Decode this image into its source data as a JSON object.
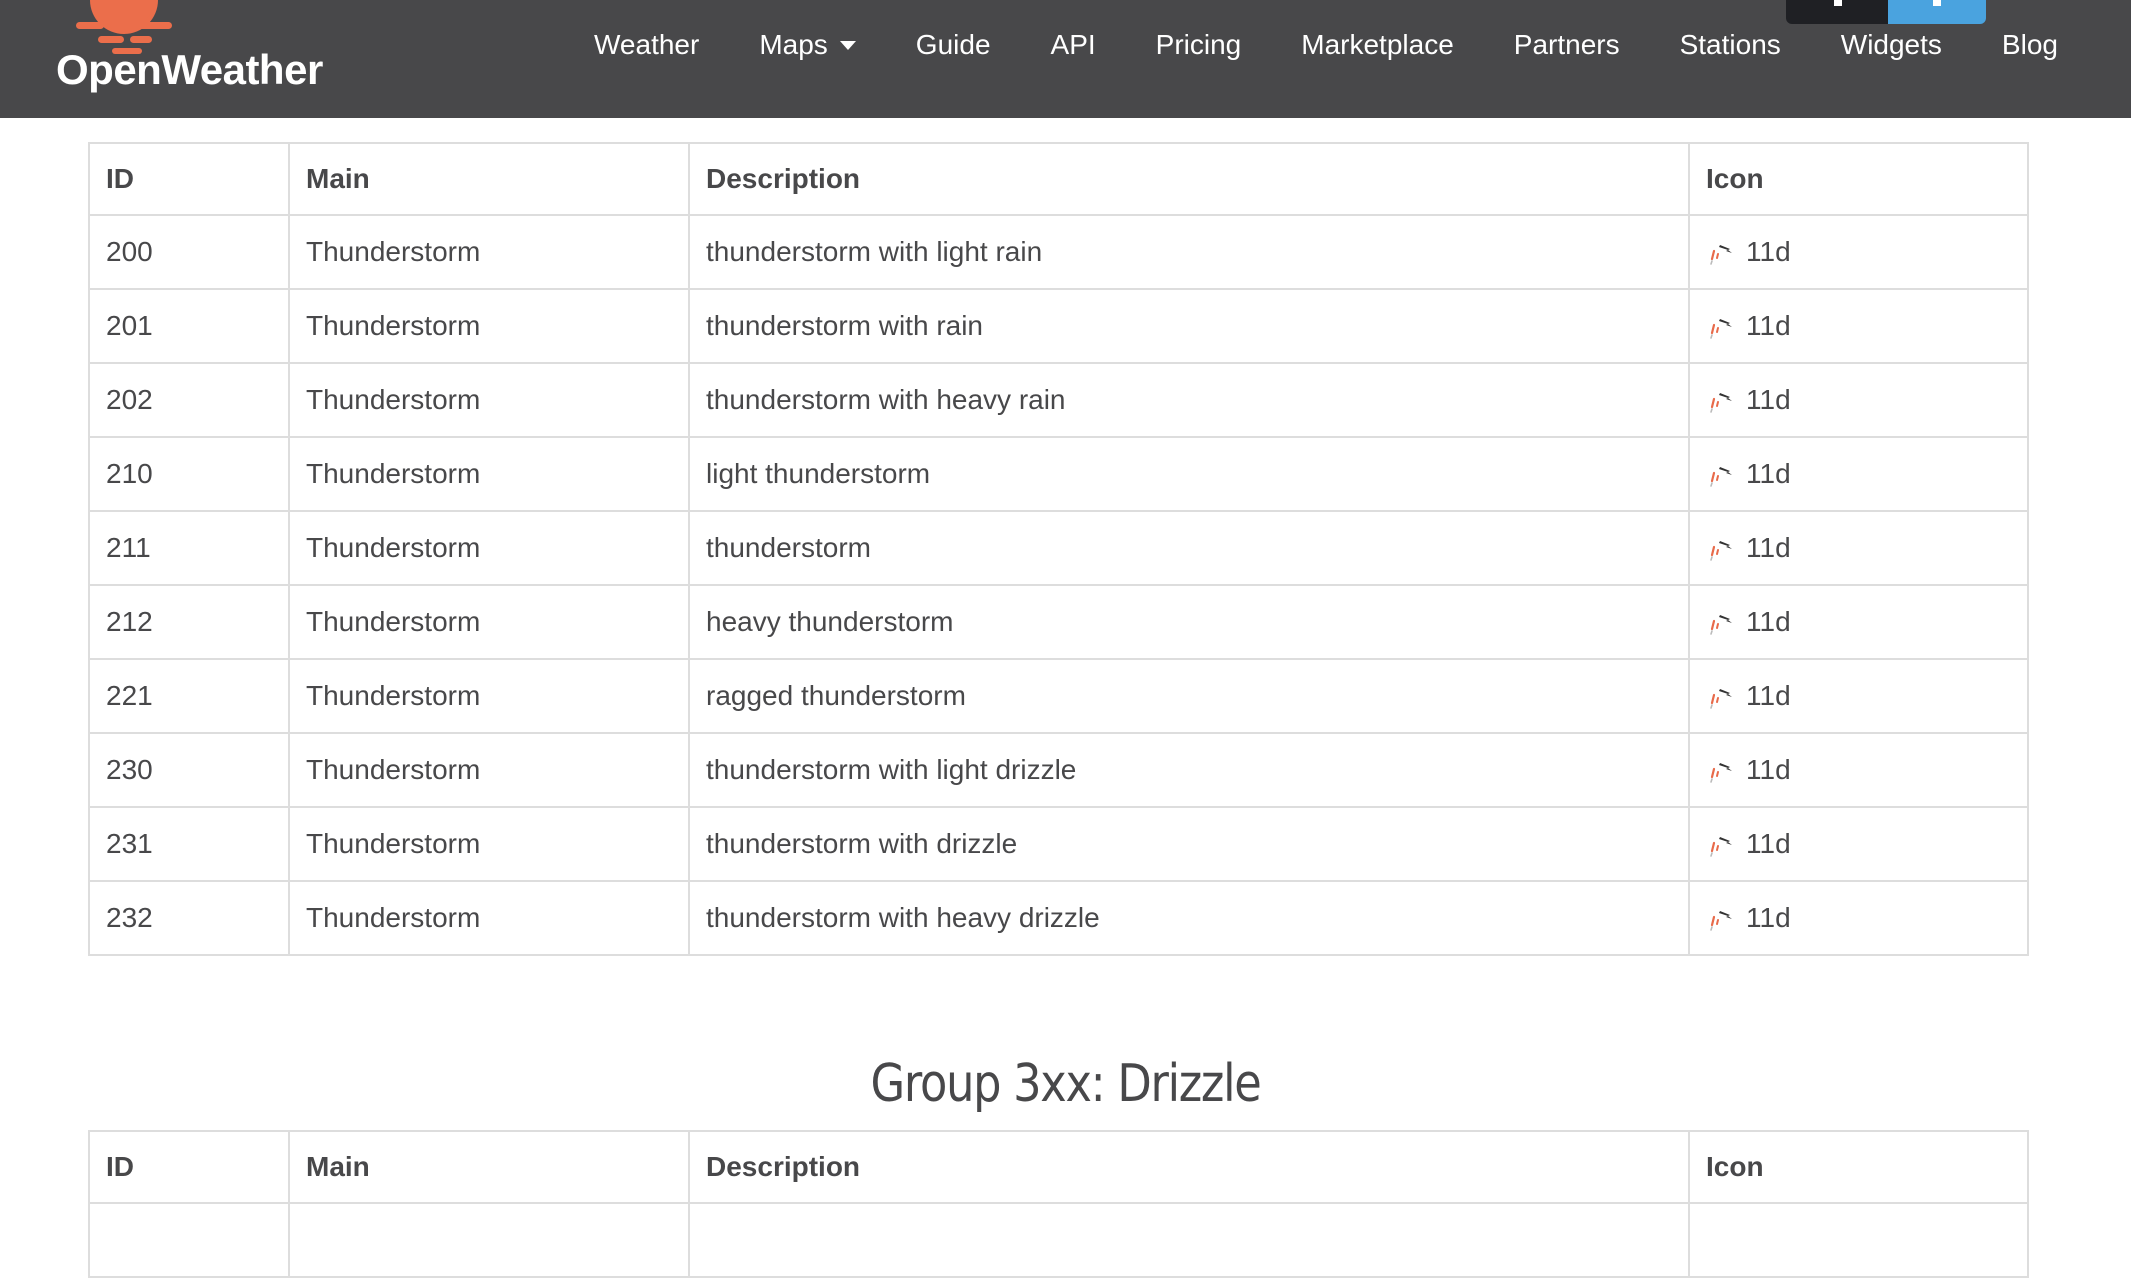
{
  "brand": {
    "name": "OpenWeather",
    "accent": "#eb6e4b"
  },
  "nav": {
    "items": [
      {
        "label": "Weather"
      },
      {
        "label": "Maps",
        "has_dropdown": true
      },
      {
        "label": "Guide"
      },
      {
        "label": "API"
      },
      {
        "label": "Pricing"
      },
      {
        "label": "Marketplace"
      },
      {
        "label": "Partners"
      },
      {
        "label": "Stations"
      },
      {
        "label": "Widgets"
      },
      {
        "label": "Blog"
      }
    ]
  },
  "columns": [
    "ID",
    "Main",
    "Description",
    "Icon"
  ],
  "group_2xx": {
    "rows": [
      {
        "id": "200",
        "main": "Thunderstorm",
        "description": "thunderstorm with light rain",
        "icon": "11d"
      },
      {
        "id": "201",
        "main": "Thunderstorm",
        "description": "thunderstorm with rain",
        "icon": "11d"
      },
      {
        "id": "202",
        "main": "Thunderstorm",
        "description": "thunderstorm with heavy rain",
        "icon": "11d"
      },
      {
        "id": "210",
        "main": "Thunderstorm",
        "description": "light thunderstorm",
        "icon": "11d"
      },
      {
        "id": "211",
        "main": "Thunderstorm",
        "description": "thunderstorm",
        "icon": "11d"
      },
      {
        "id": "212",
        "main": "Thunderstorm",
        "description": "heavy thunderstorm",
        "icon": "11d"
      },
      {
        "id": "221",
        "main": "Thunderstorm",
        "description": "ragged thunderstorm",
        "icon": "11d"
      },
      {
        "id": "230",
        "main": "Thunderstorm",
        "description": "thunderstorm with light drizzle",
        "icon": "11d"
      },
      {
        "id": "231",
        "main": "Thunderstorm",
        "description": "thunderstorm with drizzle",
        "icon": "11d"
      },
      {
        "id": "232",
        "main": "Thunderstorm",
        "description": "thunderstorm with heavy drizzle",
        "icon": "11d"
      }
    ]
  },
  "group_3xx": {
    "heading": "Group 3xx: Drizzle"
  },
  "colors": {
    "navbar_bg": "#48484a",
    "text": "#48484a",
    "border": "#dddddd",
    "button_blue": "#4aa3df"
  }
}
